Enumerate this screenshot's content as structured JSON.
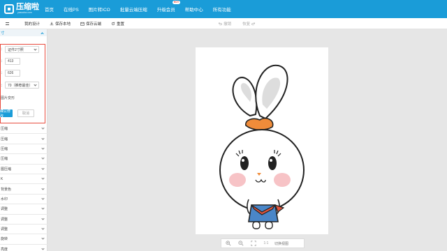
{
  "app": {
    "logo_text": "压缩啦",
    "logo_sub": "yasuoba.com",
    "nav": [
      "首页",
      "在线PS",
      "图片转ICO",
      "批量云端压缩",
      "升级会员",
      "帮助中心",
      "所有功能"
    ],
    "hot_badge": "HOT"
  },
  "toolbar": {
    "my_design": "我的设计",
    "save_local": "保存本地",
    "save_cloud": "保存云端",
    "reset": "重置",
    "undo": "撤销",
    "redo": "恢复"
  },
  "sidebar": {
    "section_head": "寸",
    "panel": {
      "size_label": "：",
      "size_value": "证件2寸照",
      "width_label": "：",
      "width_value": "413",
      "height_label": "：",
      "height_value": "626",
      "quality_label": "：",
      "quality_value": "70（推荐最佳）",
      "lock_text": "图片变形",
      "apply_label": "确认修改",
      "cancel_label": "取消"
    },
    "items": [
      "压缩",
      "压缩",
      "压缩",
      "压缩",
      "图压缩",
      "K",
      "背景色",
      "水印",
      "调整",
      "调整",
      "调整",
      "旋转",
      "亮度"
    ]
  },
  "canvas": {
    "zoom_label": "1:1",
    "fit_label": "切换视图"
  },
  "colors": {
    "brand": "#1a9cd8",
    "highlight": "#e84a3c"
  }
}
